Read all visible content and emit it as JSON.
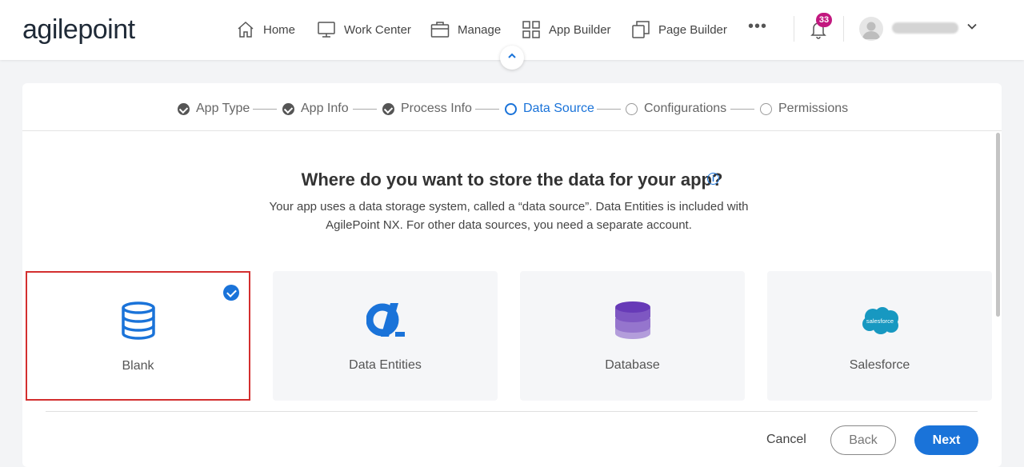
{
  "header": {
    "logo_text": "agilepoint",
    "nav": [
      {
        "label": "Home",
        "icon": "home-icon"
      },
      {
        "label": "Work Center",
        "icon": "monitor-icon"
      },
      {
        "label": "Manage",
        "icon": "briefcase-icon"
      },
      {
        "label": "App Builder",
        "icon": "grid-icon"
      },
      {
        "label": "Page Builder",
        "icon": "pages-icon"
      }
    ],
    "more_label": "•••",
    "notification_count": "33"
  },
  "wizard": {
    "steps": [
      {
        "label": "App Type",
        "state": "done"
      },
      {
        "label": "App Info",
        "state": "done"
      },
      {
        "label": "Process Info",
        "state": "done"
      },
      {
        "label": "Data Source",
        "state": "current"
      },
      {
        "label": "Configurations",
        "state": "todo"
      },
      {
        "label": "Permissions",
        "state": "todo"
      }
    ]
  },
  "main": {
    "heading": "Where do you want to store the data for your app?",
    "description": "Your app uses a data storage system, called a “data source”. Data Entities is included with AgilePoint NX. For other data sources, you need a separate account.",
    "tiles": [
      {
        "label": "Blank",
        "icon": "database-outline-icon",
        "selected": true
      },
      {
        "label": "Data Entities",
        "icon": "data-entities-icon",
        "selected": false
      },
      {
        "label": "Database",
        "icon": "database-stack-icon",
        "selected": false
      },
      {
        "label": "Salesforce",
        "icon": "salesforce-cloud-icon",
        "selected": false
      }
    ],
    "salesforce_logo_text": "salesforce"
  },
  "footer": {
    "cancel_label": "Cancel",
    "back_label": "Back",
    "next_label": "Next"
  },
  "colors": {
    "accent": "#1a73d9",
    "selected_border": "#d32f2f",
    "badge": "#c2187f",
    "database_purple": "#7e57c2",
    "salesforce_blue": "#1798c1"
  }
}
